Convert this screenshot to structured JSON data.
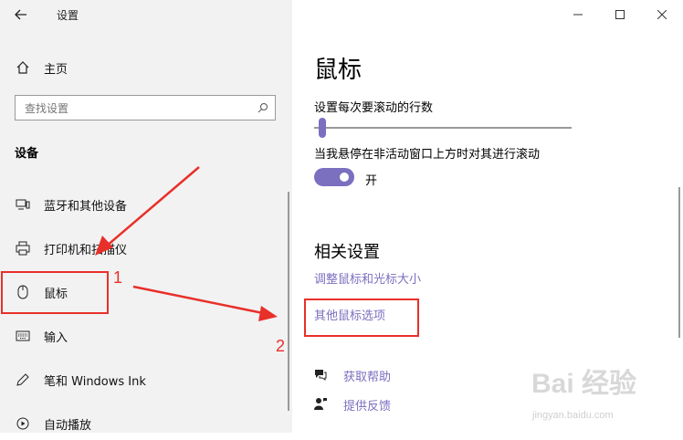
{
  "window": {
    "title": "设置"
  },
  "sidebar": {
    "home_label": "主页",
    "search_placeholder": "查找设置",
    "section_title": "设备",
    "items": [
      {
        "label": "蓝牙和其他设备",
        "icon": "bluetooth-devices-icon"
      },
      {
        "label": "打印机和扫描仪",
        "icon": "printer-icon"
      },
      {
        "label": "鼠标",
        "icon": "mouse-icon"
      },
      {
        "label": "输入",
        "icon": "keyboard-icon"
      },
      {
        "label": "笔和 Windows Ink",
        "icon": "pen-icon"
      },
      {
        "label": "自动播放",
        "icon": "autoplay-icon"
      }
    ]
  },
  "main": {
    "title": "鼠标",
    "scroll_lines_label": "设置每次要滚动的行数",
    "inactive_scroll_label": "当我悬停在非活动窗口上方时对其进行滚动",
    "toggle_state": "开",
    "related_title": "相关设置",
    "related_links": [
      "调整鼠标和光标大小",
      "其他鼠标选项"
    ],
    "help_links": [
      {
        "label": "获取帮助",
        "icon": "help-chat-icon"
      },
      {
        "label": "提供反馈",
        "icon": "feedback-icon"
      }
    ]
  },
  "annotations": {
    "marker_1": "1",
    "marker_2": "2",
    "color": "#e8302a"
  },
  "watermark": {
    "text": "Bai 经验",
    "url": "jingyan.baidu.com"
  },
  "colors": {
    "accent": "#7b6fbf",
    "sidebar_bg": "#f2f2f2",
    "annotation": "#e8302a"
  }
}
